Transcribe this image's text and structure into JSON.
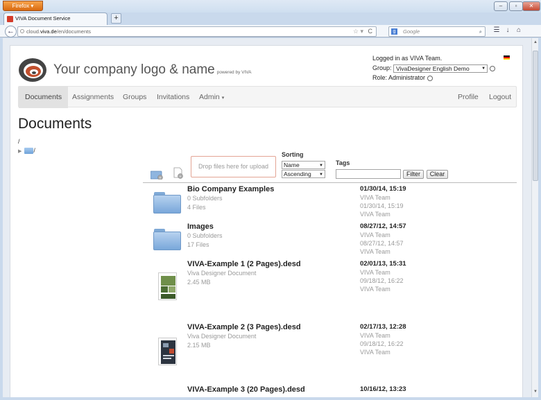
{
  "browser": {
    "menu_button": "Firefox",
    "tab_title": "VIVA Document Service",
    "new_tab": "+",
    "url_host": "cloud.viva.de",
    "url_path": "/en/documents",
    "search_placeholder": "Google"
  },
  "header": {
    "logo_text": "Your company logo & name",
    "powered_by": "powered by VIVA",
    "logged_in": "Logged in as VIVA Team.",
    "group_label": "Group:",
    "group_value": "VivaDesigner English Demo",
    "role": "Role: Administrator"
  },
  "nav": {
    "documents": "Documents",
    "assignments": "Assignments",
    "groups": "Groups",
    "invitations": "Invitations",
    "admin": "Admin",
    "profile": "Profile",
    "logout": "Logout"
  },
  "page": {
    "title": "Documents",
    "breadcrumb": "/",
    "tree_root": "/"
  },
  "toolbar": {
    "dropzone": "Drop files here for upload",
    "sorting_label": "Sorting",
    "sort_field": "Name",
    "sort_order": "Ascending",
    "tags_label": "Tags",
    "tags_value": "",
    "filter": "Filter",
    "clear": "Clear"
  },
  "entries": [
    {
      "name": "Bio Company Examples",
      "line1": "0 Subfolders",
      "line2": "4 Files",
      "date": "01/30/14, 15:19",
      "owner": "VIVA Team",
      "date2": "01/30/14, 15:19",
      "owner2": "VIVA Team"
    },
    {
      "name": "Images",
      "line1": "0 Subfolders",
      "line2": "17 Files",
      "date": "08/27/12, 14:57",
      "owner": "VIVA Team",
      "date2": "08/27/12, 14:57",
      "owner2": "VIVA Team"
    },
    {
      "name": "VIVA-Example 1 (2 Pages).desd",
      "line1": "Viva Designer Document",
      "line2": "2.45 MB",
      "date": "02/01/13, 15:31",
      "owner": "VIVA Team",
      "date2": "09/18/12, 16:22",
      "owner2": "VIVA Team"
    },
    {
      "name": "VIVA-Example 2 (3 Pages).desd",
      "line1": "Viva Designer Document",
      "line2": "2.15 MB",
      "date": "02/17/13, 12:28",
      "owner": "VIVA Team",
      "date2": "09/18/12, 16:22",
      "owner2": "VIVA Team"
    },
    {
      "name": "VIVA-Example 3 (20 Pages).desd",
      "date": "10/16/12, 13:23"
    }
  ]
}
